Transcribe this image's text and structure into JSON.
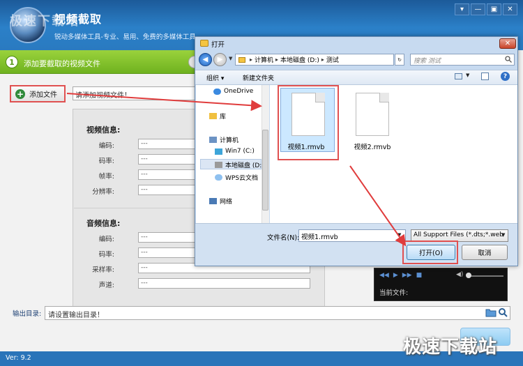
{
  "app": {
    "title": "视频截取",
    "subtitle": "锐动多媒体工具-专业、易用、免费的多媒体工具",
    "watermark_top": "极速下载站",
    "watermark_bottom": "极速下载站",
    "version": "Ver: 9.2",
    "window_controls": [
      "▾",
      "—",
      "▣",
      "✕"
    ]
  },
  "steps": {
    "step1_number": "1",
    "step1_label": "添加要截取的视频文件"
  },
  "add_file": {
    "label": "添加文件",
    "input_value": "请添加视频文件！"
  },
  "video_info": {
    "title": "视频信息:",
    "fields": [
      {
        "label": "编码:",
        "value": "---"
      },
      {
        "label": "码率:",
        "value": "---"
      },
      {
        "label": "帧率:",
        "value": "---"
      },
      {
        "label": "分辨率:",
        "value": "---"
      }
    ]
  },
  "audio_info": {
    "title": "音频信息:",
    "fields": [
      {
        "label": "编码:",
        "value": "---"
      },
      {
        "label": "码率:",
        "value": "---"
      },
      {
        "label": "采样率:",
        "value": "---"
      },
      {
        "label": "声道:",
        "value": "---"
      }
    ]
  },
  "player": {
    "current_file_label": "当前文件:"
  },
  "output": {
    "label": "输出目录:",
    "value": "请设置输出目录！"
  },
  "dialog": {
    "title": "打开",
    "breadcrumbs": [
      "计算机",
      "本地磁盘 (D:)",
      "测试"
    ],
    "search_placeholder": "搜索 测试",
    "organize": "组织 ▾",
    "new_folder": "新建文件夹",
    "help": "?",
    "nav_items": [
      {
        "label": "OneDrive",
        "icon": "cloud-icon"
      },
      {
        "label": "库",
        "icon": "library-icon"
      },
      {
        "label": "计算机",
        "icon": "computer-icon"
      },
      {
        "label": "Win7 (C:)",
        "icon": "drive-icon"
      },
      {
        "label": "本地磁盘 (D:)",
        "icon": "drive-icon"
      },
      {
        "label": "WPS云文档",
        "icon": "cloud-icon"
      },
      {
        "label": "网络",
        "icon": "network-icon"
      }
    ],
    "files": [
      {
        "name": "视频1.rmvb"
      },
      {
        "name": "视频2.rmvb"
      }
    ],
    "filename_label": "文件名(N):",
    "filename_value": "视频1.rmvb",
    "filetype_value": "All Support Files (*.dts;*.web",
    "open_label": "打开(O)",
    "cancel_label": "取消"
  },
  "colors": {
    "accent_red": "#e05050",
    "header_blue": "#2b80c8",
    "step_green": "#7ab82a"
  }
}
